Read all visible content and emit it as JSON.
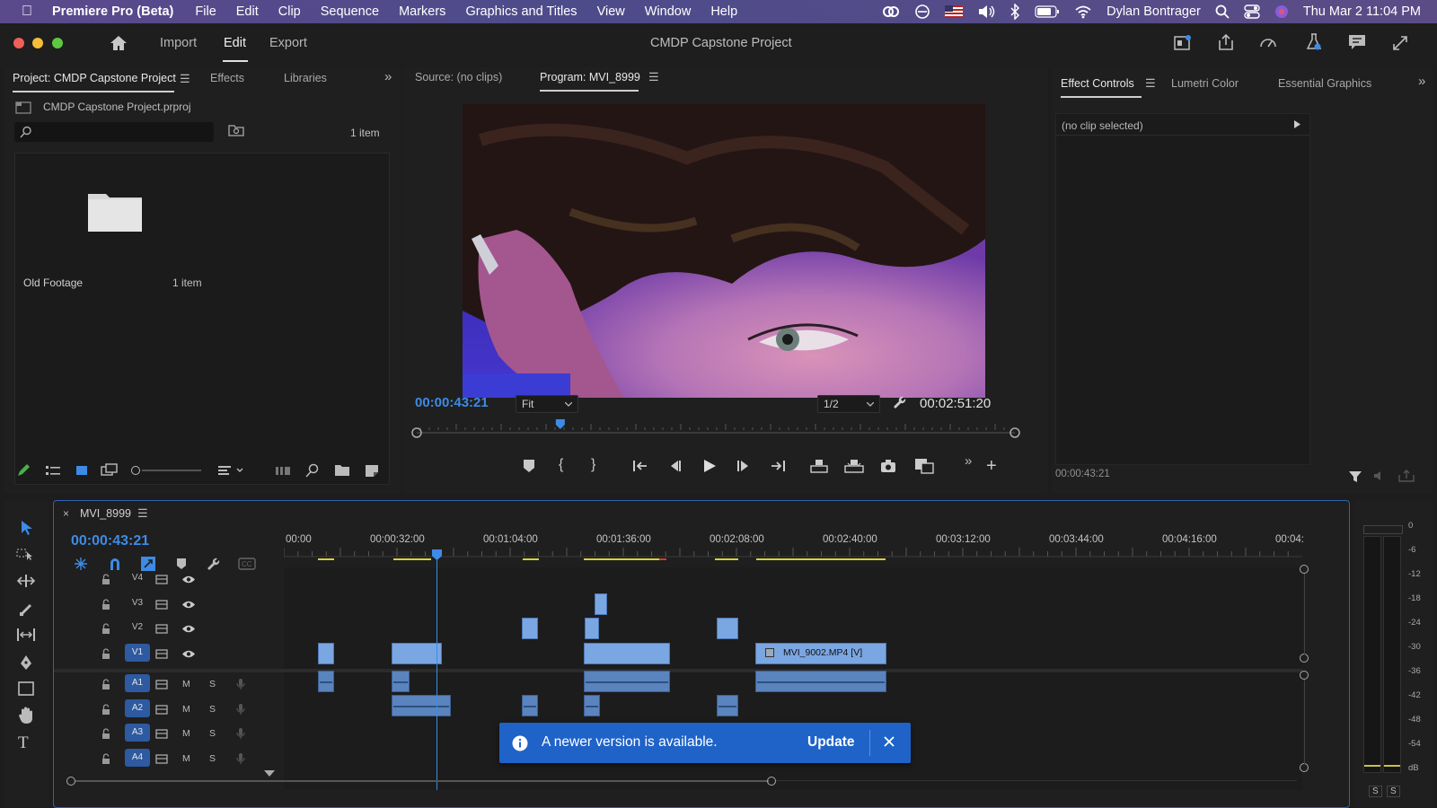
{
  "menubar": {
    "app_name": "Premiere Pro (Beta)",
    "items": [
      "File",
      "Edit",
      "Clip",
      "Sequence",
      "Markers",
      "Graphics and Titles",
      "View",
      "Window",
      "Help"
    ],
    "user": "Dylan Bontrager",
    "datetime": "Thu Mar 2  11:04 PM"
  },
  "header": {
    "title": "CMDP Capstone Project",
    "workspaces": [
      "Import",
      "Edit",
      "Export"
    ],
    "active_workspace": "Edit"
  },
  "project_panel": {
    "tabs": [
      "Project: CMDP Capstone Project",
      "Effects",
      "Libraries"
    ],
    "file_name": "CMDP Capstone Project.prproj",
    "search_placeholder": "",
    "item_count": "1 item",
    "bin": {
      "name": "Old Footage",
      "count": "1 item"
    }
  },
  "monitor": {
    "source_tab": "Source: (no clips)",
    "program_tab": "Program: MVI_8999",
    "timecode": "00:00:43:21",
    "fit": "Fit",
    "resolution": "1/2",
    "duration": "00:02:51:20",
    "playhead_fraction": 0.24
  },
  "effects_panel": {
    "tabs": [
      "Effect Controls",
      "Lumetri Color",
      "Essential Graphics"
    ],
    "no_clip": "(no clip selected)",
    "timecode": "00:00:43:21"
  },
  "timeline": {
    "sequence_name": "MVI_8999",
    "timecode": "00:00:43:21",
    "ruler": [
      "00:00",
      "00:00:32:00",
      "00:01:04:00",
      "00:01:36:00",
      "00:02:08:00",
      "00:02:40:00",
      "00:03:12:00",
      "00:03:44:00",
      "00:04:16:00",
      "00:04:"
    ],
    "video_tracks": [
      "V4",
      "V3",
      "V2",
      "V1"
    ],
    "audio_tracks": [
      "A1",
      "A2",
      "A3",
      "A4"
    ],
    "mute_label": "M",
    "solo_label": "S",
    "clip_label": "MVI_9002.MP4 [V]",
    "clip_badge": "fx"
  },
  "meter": {
    "scale": [
      "0",
      "-6",
      "-12",
      "-18",
      "-24",
      "-30",
      "-36",
      "-42",
      "-48",
      "-54",
      "dB"
    ],
    "solo_buttons": [
      "S",
      "S"
    ]
  },
  "toast": {
    "message": "A newer version is available.",
    "action": "Update",
    "bg": "#1f63c8"
  },
  "colors": {
    "accent": "#3d8be6",
    "clip_video": "#7aa6e2",
    "clip_audio": "#5a84be"
  }
}
